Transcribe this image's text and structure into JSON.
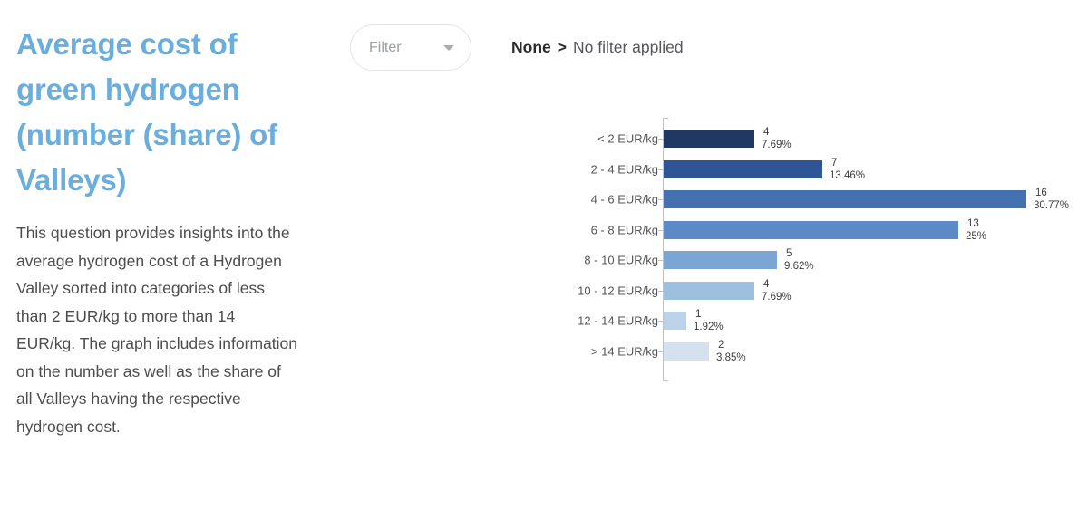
{
  "panel": {
    "title": "Average cost of green hydrogen (number (share) of Valleys)",
    "description": "This question provides insights into the average hydrogen cost of a Hydrogen Valley sorted into categories of less than 2 EUR/kg to more than 14 EUR/kg. The graph includes information on the number as well as the share of all Valleys having the respective hydrogen cost.",
    "title_color": "#6aaedd"
  },
  "filter": {
    "placeholder": "Filter",
    "caret_icon": "chevron-down-icon",
    "status_label": "None",
    "status_separator": ">",
    "status_value": "No filter applied"
  },
  "chart_data": {
    "type": "bar",
    "orientation": "horizontal",
    "title": "",
    "xlabel": "",
    "ylabel": "",
    "categories": [
      "< 2 EUR/kg",
      "2 - 4 EUR/kg",
      "4 - 6 EUR/kg",
      "6 - 8 EUR/kg",
      "8 - 10 EUR/kg",
      "10 - 12 EUR/kg",
      "12 - 14 EUR/kg",
      "> 14 EUR/kg"
    ],
    "values": [
      4,
      7,
      16,
      13,
      5,
      4,
      1,
      2
    ],
    "value_labels": [
      "4",
      "7",
      "16",
      "13",
      "5",
      "4",
      "1",
      "2"
    ],
    "share_labels": [
      "7.69%",
      "13.46%",
      "30.77%",
      "25%",
      "9.62%",
      "7.69%",
      "1.92%",
      "3.85%"
    ],
    "bar_colors": [
      "#203864",
      "#2f5597",
      "#4472b0",
      "#5b8ac4",
      "#7ba6d4",
      "#9cc0dd",
      "#bdd3e9",
      "#d4e2f0"
    ],
    "xlim": [
      0,
      16
    ],
    "grid": false,
    "legend": "none"
  }
}
